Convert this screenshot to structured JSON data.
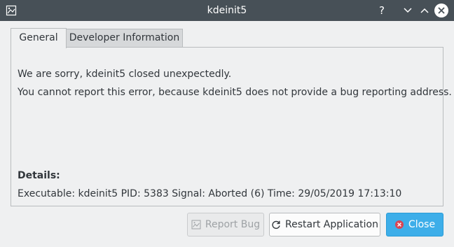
{
  "window": {
    "title": "kdeinit5",
    "help_glyph": "?",
    "icons": [
      "app-icon",
      "help-icon",
      "minimize-icon",
      "maximize-icon",
      "close-icon"
    ]
  },
  "tabs": [
    {
      "label": "General",
      "active": true
    },
    {
      "label": "Developer Information",
      "active": false
    }
  ],
  "general": {
    "message_line1": "We are sorry, kdeinit5 closed unexpectedly.",
    "message_line2": "You cannot report this error, because kdeinit5 does not provide a bug reporting address.",
    "details_label": "Details:",
    "details_text": "Executable: kdeinit5 PID: 5383 Signal: Aborted (6) Time: 29/05/2019 17:13:10"
  },
  "buttons": {
    "report_bug": "Report Bug",
    "restart": "Restart Application",
    "close": "Close"
  },
  "colors": {
    "titlebar": "#475057",
    "window_bg": "#eff0f1",
    "accent": "#3daee9",
    "close_icon_red": "#da4453"
  }
}
